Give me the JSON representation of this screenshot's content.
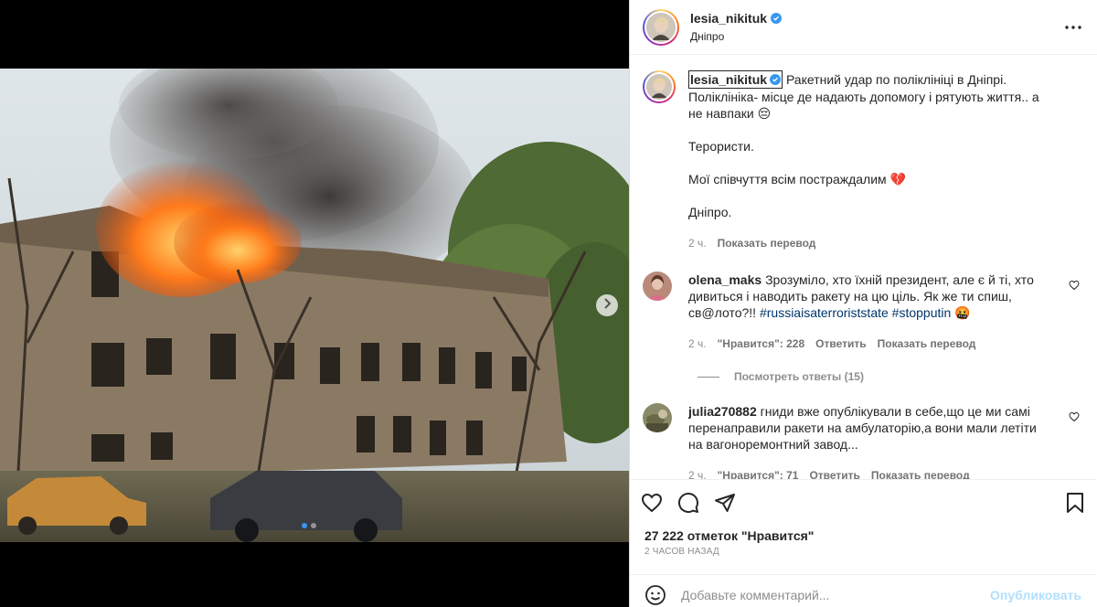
{
  "post": {
    "username": "lesia_nikituk",
    "location": "Дніпро",
    "verified": true
  },
  "caption": {
    "username": "lesia_nikituk",
    "line1": "Ракетний удар по поліклініці в Дніпрі.",
    "line2": "Поліклініка- місце де надають допомогу і рятують життя.. а не навпаки",
    "emoji1": "😔",
    "para2": "Терористи.",
    "para3": "Мої співчуття всім постраждалим",
    "emoji3": "💔",
    "para4": "Дніпро.",
    "time": "2 ч.",
    "translate": "Показать перевод"
  },
  "comments": [
    {
      "username": "olena_maks",
      "text": "Зрозуміло, хто їхній президент, але є й ті, хто дивиться і наводить ракету на цю ціль. Як же ти спиш, св@лото?!!",
      "hashtag1": "#russiaisaterroriststate",
      "hashtag2": "#stopputin",
      "emoji": "🤬",
      "time": "2 ч.",
      "likes": "\"Нравится\": 228",
      "reply": "Ответить",
      "translate": "Показать перевод",
      "view_replies": "Посмотреть ответы (15)"
    },
    {
      "username": "julia270882",
      "text": "гниди вже опублікували в себе,що це ми самі перенаправили ракети на амбулаторію,а вони мали летіти на вагоноремонтний завод...",
      "time": "2 ч.",
      "likes": "\"Нравится\": 71",
      "reply": "Ответить",
      "translate": "Показать перевод"
    }
  ],
  "likes_summary": "27 222 отметок \"Нравится\"",
  "time_ago": "2 ЧАСОВ НАЗАД",
  "add_comment": {
    "placeholder": "Добавьте комментарий...",
    "publish": "Опубликовать"
  },
  "carousel": {
    "current": 1,
    "total": 2
  },
  "icons": {
    "more": "more-horizontal-icon",
    "next": "chevron-right-icon",
    "like": "heart-icon",
    "comment": "comment-icon",
    "share": "share-icon",
    "save": "bookmark-icon",
    "emoji": "emoji-icon"
  },
  "colors": {
    "verified": "#3897f0",
    "link": "#00376b",
    "publish_disabled": "#b2dffc",
    "muted": "#8e8e8e"
  }
}
